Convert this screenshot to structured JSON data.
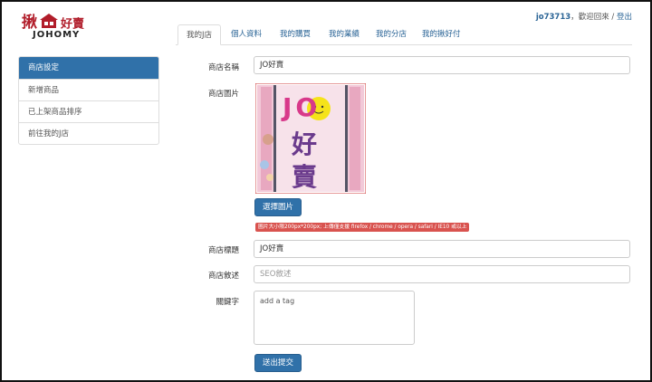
{
  "logo": {
    "chinese_left": "揪",
    "chinese_right": "好賣",
    "english": "JOHOMY"
  },
  "user": {
    "username": "jo73713",
    "separator": "，",
    "welcome": "歡迎回來",
    "slash": " / ",
    "logout": "登出"
  },
  "tabs": [
    {
      "label": "我的J店",
      "active": true
    },
    {
      "label": "個人資料",
      "active": false
    },
    {
      "label": "我的購買",
      "active": false
    },
    {
      "label": "我的業績",
      "active": false
    },
    {
      "label": "我的分店",
      "active": false
    },
    {
      "label": "我的揪好付",
      "active": false
    }
  ],
  "sidebar": {
    "items": [
      {
        "label": "商店設定",
        "active": true
      },
      {
        "label": "新增商品",
        "active": false
      },
      {
        "label": "已上架商品排序",
        "active": false
      },
      {
        "label": "前往我的J店",
        "active": false
      }
    ]
  },
  "form": {
    "store_name": {
      "label": "商店名稱",
      "value": "JO好賣"
    },
    "store_image": {
      "label": "商店圖片",
      "image_text_top": "JO",
      "image_text_mid": "好",
      "image_text_bottom": "賣",
      "button": "選擇圖片",
      "notice": "圖片大小限200px*200px; 上傳僅支援 firefox / chrome / opera / safari / IE10 或以上"
    },
    "store_title": {
      "label": "商店標題",
      "value": "JO好賣"
    },
    "store_desc": {
      "label": "商店敘述",
      "placeholder": "SEO敘述"
    },
    "keywords": {
      "label": "關鍵字",
      "placeholder": "add a tag"
    },
    "submit": "送出提交"
  },
  "colors": {
    "brand_red": "#b11d2a",
    "primary_blue": "#3071a9",
    "link_blue": "#2a6496",
    "notice_red": "#d9534f"
  }
}
